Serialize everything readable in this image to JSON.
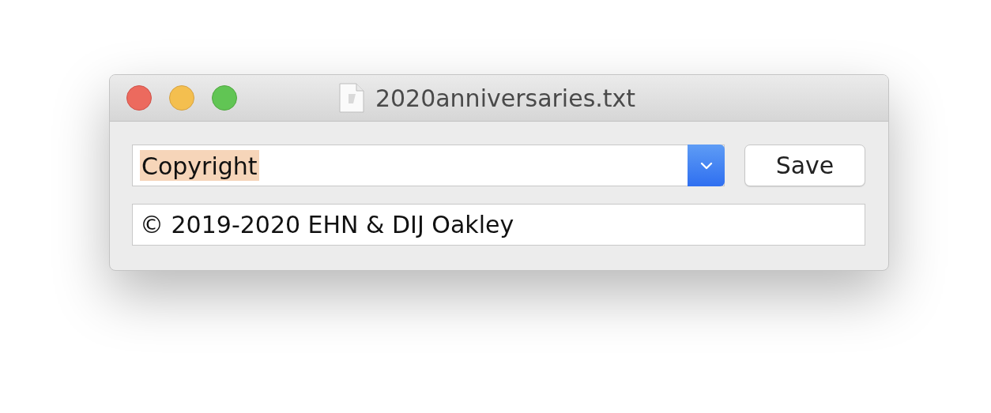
{
  "window": {
    "title": "2020anniversaries.txt"
  },
  "combo": {
    "value": "Copyright",
    "text_selected": true
  },
  "save_button": {
    "label": "Save"
  },
  "text_field": {
    "value": "© 2019-2020 EHN & DIJ Oakley"
  }
}
